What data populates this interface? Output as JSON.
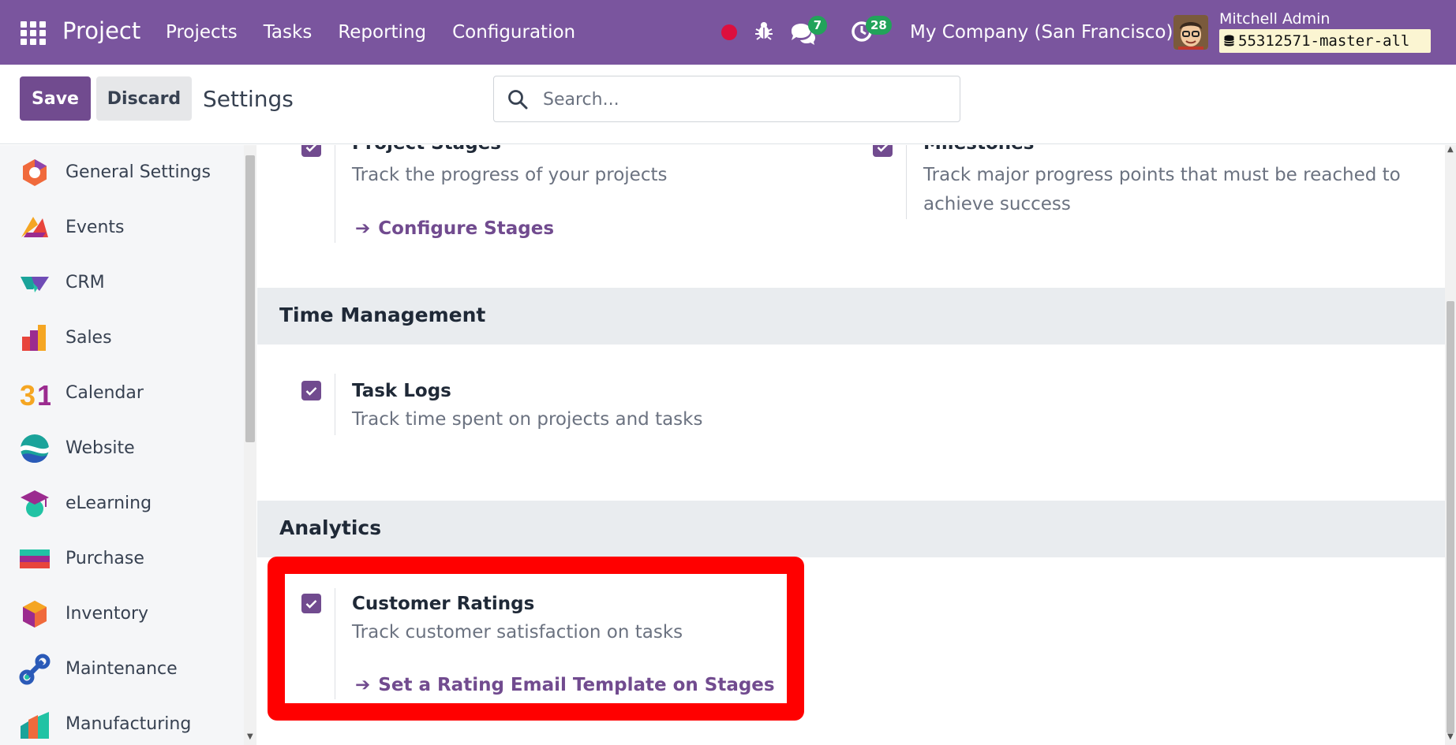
{
  "navbar": {
    "brand": "Project",
    "menu": [
      "Projects",
      "Tasks",
      "Reporting",
      "Configuration"
    ],
    "messages_count": "7",
    "activities_count": "28",
    "company": "My Company (San Francisco)",
    "user_name": "Mitchell Admin",
    "database": "55312571-master-all"
  },
  "control": {
    "save_label": "Save",
    "discard_label": "Discard",
    "breadcrumb": "Settings",
    "search_placeholder": "Search..."
  },
  "sidebar": {
    "items": [
      {
        "label": "General Settings",
        "icon": "general-settings-icon"
      },
      {
        "label": "Events",
        "icon": "events-icon"
      },
      {
        "label": "CRM",
        "icon": "crm-icon"
      },
      {
        "label": "Sales",
        "icon": "sales-icon"
      },
      {
        "label": "Calendar",
        "icon": "calendar-icon"
      },
      {
        "label": "Website",
        "icon": "website-icon"
      },
      {
        "label": "eLearning",
        "icon": "elearning-icon"
      },
      {
        "label": "Purchase",
        "icon": "purchase-icon"
      },
      {
        "label": "Inventory",
        "icon": "inventory-icon"
      },
      {
        "label": "Maintenance",
        "icon": "maintenance-icon"
      },
      {
        "label": "Manufacturing",
        "icon": "manufacturing-icon"
      }
    ]
  },
  "settings": {
    "project_stages": {
      "title": "Project Stages",
      "desc": "Track the progress of your projects",
      "link": "Configure Stages",
      "checked": true
    },
    "milestones": {
      "title": "Milestones",
      "desc": "Track major progress points that must be reached to achieve success",
      "checked": true
    },
    "time_management": {
      "heading": "Time Management",
      "task_logs": {
        "title": "Task Logs",
        "desc": "Track time spent on projects and tasks",
        "checked": true
      }
    },
    "analytics": {
      "heading": "Analytics",
      "customer_ratings": {
        "title": "Customer Ratings",
        "desc": "Track customer satisfaction on tasks",
        "link": "Set a Rating Email Template on Stages",
        "checked": true
      }
    }
  },
  "colors": {
    "navbar": "#7a559e",
    "primary": "#714b8f",
    "badge": "#22a35a",
    "highlight": "#ff0000"
  }
}
